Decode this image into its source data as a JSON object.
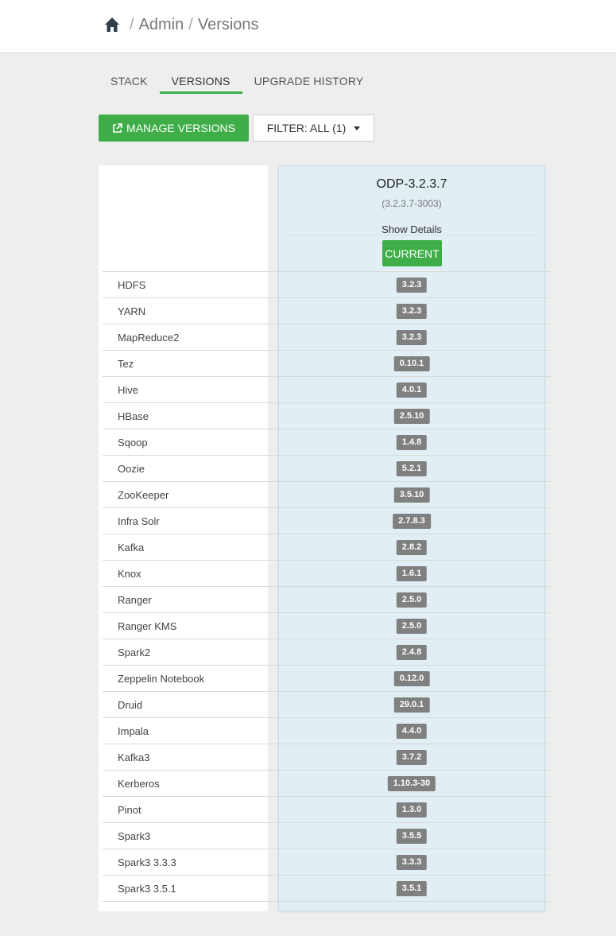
{
  "breadcrumb": {
    "section": "Admin",
    "current": "Versions",
    "separator": "/"
  },
  "tabs": [
    {
      "label": "STACK",
      "active": false
    },
    {
      "label": "VERSIONS",
      "active": true
    },
    {
      "label": "UPGRADE HISTORY",
      "active": false
    }
  ],
  "toolbar": {
    "manage_label": "MANAGE VERSIONS",
    "filter_label": "FILTER: ALL (1)"
  },
  "version": {
    "name": "ODP-3.2.3.7",
    "build": "(3.2.3.7-3003)",
    "details_label": "Show Details",
    "status_label": "CURRENT"
  },
  "services": [
    {
      "name": "HDFS",
      "version": "3.2.3"
    },
    {
      "name": "YARN",
      "version": "3.2.3"
    },
    {
      "name": "MapReduce2",
      "version": "3.2.3"
    },
    {
      "name": "Tez",
      "version": "0.10.1"
    },
    {
      "name": "Hive",
      "version": "4.0.1"
    },
    {
      "name": "HBase",
      "version": "2.5.10"
    },
    {
      "name": "Sqoop",
      "version": "1.4.8"
    },
    {
      "name": "Oozie",
      "version": "5.2.1"
    },
    {
      "name": "ZooKeeper",
      "version": "3.5.10"
    },
    {
      "name": "Infra Solr",
      "version": "2.7.8.3"
    },
    {
      "name": "Kafka",
      "version": "2.8.2"
    },
    {
      "name": "Knox",
      "version": "1.6.1"
    },
    {
      "name": "Ranger",
      "version": "2.5.0"
    },
    {
      "name": "Ranger KMS",
      "version": "2.5.0"
    },
    {
      "name": "Spark2",
      "version": "2.4.8"
    },
    {
      "name": "Zeppelin Notebook",
      "version": "0.12.0"
    },
    {
      "name": "Druid",
      "version": "29.0.1"
    },
    {
      "name": "Impala",
      "version": "4.4.0"
    },
    {
      "name": "Kafka3",
      "version": "3.7.2"
    },
    {
      "name": "Kerberos",
      "version": "1.10.3-30"
    },
    {
      "name": "Pinot",
      "version": "1.3.0"
    },
    {
      "name": "Spark3",
      "version": "3.5.5"
    },
    {
      "name": "Spark3 3.3.3",
      "version": "3.3.3"
    },
    {
      "name": "Spark3 3.5.1",
      "version": "3.5.1"
    }
  ],
  "colors": {
    "accent": "#3fae49",
    "badge": "#808080",
    "column_bg": "#e1eef4"
  }
}
